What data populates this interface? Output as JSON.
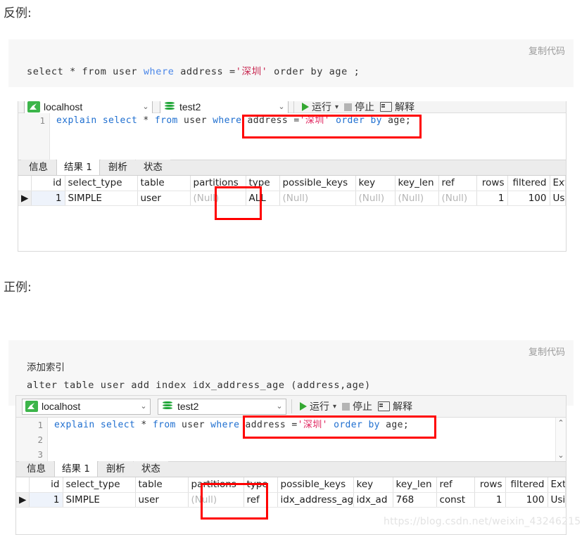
{
  "sections": {
    "counter_example_title": "反例:",
    "good_example_title": "正例:"
  },
  "code_blocks": {
    "copy_label": "复制代码",
    "counter_sql": {
      "pre": "select * from user ",
      "kw": "where",
      "mid": " address =",
      "str": "'深圳'",
      "post": " order by age ;"
    },
    "example_comment": "添加索引",
    "example_sql": "alter table user add index idx_address_age (address,age)"
  },
  "navicat": {
    "connection": "localhost",
    "database": "test2",
    "toolbar": {
      "run": "运行",
      "run_caret": "▾",
      "stop": "停止",
      "explain": "解释"
    },
    "editor": {
      "line_numbers_short": [
        "1"
      ],
      "line_numbers_long": [
        "1",
        "2",
        "3"
      ],
      "sql": {
        "kw1": "explain select",
        "mid1": " * ",
        "kw2": "from",
        "mid2": " user ",
        "kw3": "where",
        "mid3": " address =",
        "str": "'深圳'",
        "kw4": " order by",
        "mid4": " age;"
      },
      "scroll_up": "⌃",
      "scroll_down": "⌄"
    },
    "tabs": [
      {
        "label": "信息",
        "active": false
      },
      {
        "label": "结果 1",
        "active": true
      },
      {
        "label": "剖析",
        "active": false
      },
      {
        "label": "状态",
        "active": false
      }
    ],
    "grid_columns": [
      "id",
      "select_type",
      "table",
      "partitions",
      "type",
      "possible_keys",
      "key",
      "key_len",
      "ref",
      "rows",
      "filtered",
      "Extra"
    ],
    "row_marker": "▶",
    "grid_row_counter": {
      "id": "1",
      "select_type": "SIMPLE",
      "table": "user",
      "partitions": "(Null)",
      "type": "ALL",
      "possible_keys": "(Null)",
      "key": "(Null)",
      "key_len": "(Null)",
      "ref": "(Null)",
      "rows": "1",
      "filtered": "100",
      "Extra": "Using"
    },
    "grid_row_example": {
      "id": "1",
      "select_type": "SIMPLE",
      "table": "user",
      "partitions": "(Null)",
      "type": "ref",
      "possible_keys": "idx_address_age",
      "key": "idx_ad",
      "key_len": "768",
      "ref": "const",
      "rows": "1",
      "filtered": "100",
      "Extra": "Using"
    }
  },
  "watermark": "https://blog.csdn.net/weixin_43246215",
  "colors": {
    "annotation_red": "#ff0000",
    "keyword_blue": "#1f6fd0",
    "string_red": "#e0245e",
    "code_bg": "#f7f7f7",
    "accent_green": "#34a832"
  }
}
